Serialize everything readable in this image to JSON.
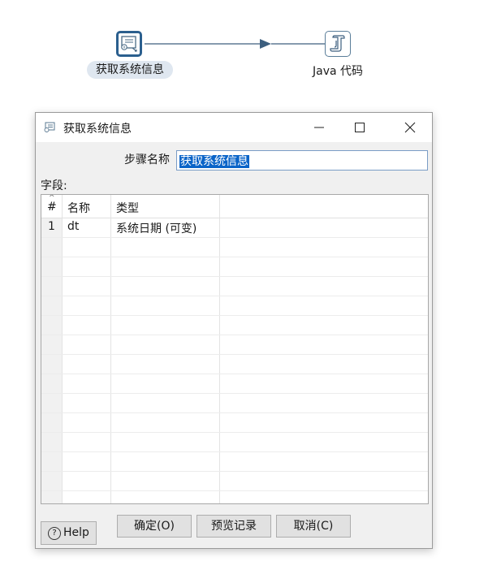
{
  "canvas": {
    "steps": [
      {
        "label": "获取系统信息",
        "icon": "system-info-step-icon"
      },
      {
        "label": "Java 代码",
        "icon": "java-code-step-icon"
      }
    ],
    "hop_icon": "arrow-right-icon"
  },
  "dialog": {
    "title": "获取系统信息",
    "title_icon": "system-info-icon",
    "window_controls": {
      "minimize": "minimize-icon",
      "maximize": "maximize-icon",
      "close": "close-icon"
    },
    "step_name_label": "步骤名称",
    "step_name_value": "获取系统信息",
    "fields_label": "字段:",
    "table": {
      "columns": [
        "#",
        "名称",
        "类型"
      ],
      "rows": [
        {
          "num": "1",
          "name": "dt",
          "type": "系统日期 (可变)"
        }
      ]
    },
    "buttons": {
      "help": "Help",
      "ok": "确定(O)",
      "preview": "预览记录",
      "cancel": "取消(C)"
    }
  },
  "colors": {
    "selection": "#0a64c8",
    "step_border": "#2b5f8e",
    "hop_line": "#3d5f7f",
    "label_highlight": "#dfe7f0"
  }
}
